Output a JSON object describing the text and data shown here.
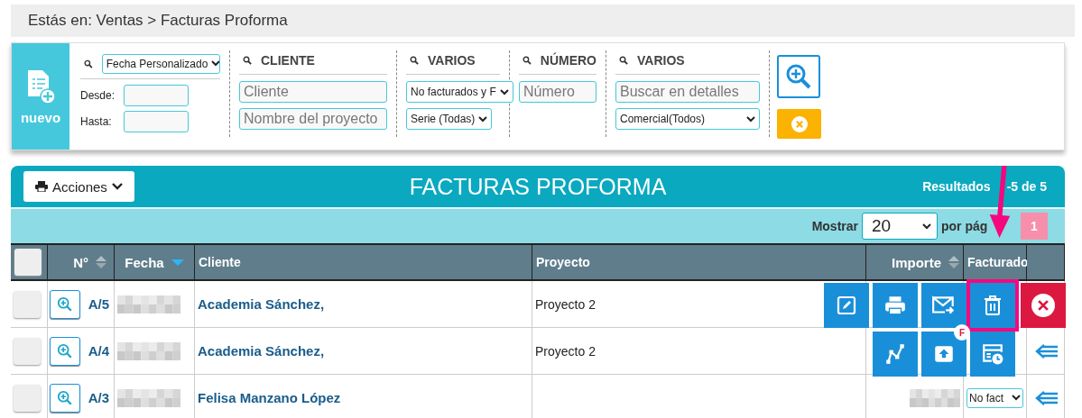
{
  "breadcrumb": "Estás en: Ventas > Facturas Proforma",
  "new_button": {
    "label": "nuevo"
  },
  "date_filter": {
    "select": "Fecha Personalizado",
    "from_label": "Desde:",
    "to_label": "Hasta:"
  },
  "filter_groups": [
    {
      "title": "CLIENTE",
      "fields": [
        {
          "kind": "input",
          "placeholder": "Cliente"
        },
        {
          "kind": "input",
          "placeholder": "Nombre del proyecto"
        }
      ]
    },
    {
      "title": "VARIOS",
      "fields": [
        {
          "kind": "select",
          "value": "No facturados y F"
        },
        {
          "kind": "select",
          "value": "Serie (Todas)"
        }
      ]
    },
    {
      "title": "NÚMERO",
      "fields": [
        {
          "kind": "input",
          "placeholder": "Número"
        }
      ]
    },
    {
      "title": "VARIOS",
      "fields": [
        {
          "kind": "input",
          "placeholder": "Buscar en detalles"
        },
        {
          "kind": "select",
          "value": "Comercial(Todos)"
        }
      ]
    }
  ],
  "table": {
    "title": "FACTURAS PROFORMA",
    "actions_button": "Acciones",
    "results": [
      "Resultados",
      "-5 de 5"
    ],
    "show_label": "Mostrar",
    "page_size": "20",
    "per_page_label": "por pág",
    "pages": [
      {
        "label": "1",
        "selected": true
      }
    ],
    "select_all_checked": false,
    "columns": [
      {
        "label": "N°",
        "sortable": true,
        "sorted": false
      },
      {
        "label": "Fecha",
        "sortable": true,
        "sorted": true
      },
      {
        "label": "Cliente",
        "sortable": false
      },
      {
        "label": "Proyecto",
        "sortable": false
      },
      {
        "label": "Importe",
        "sortable": true,
        "sorted": false
      },
      {
        "label": "Facturado",
        "sortable": false
      }
    ],
    "rows": [
      {
        "number": "A/5",
        "client": "Academia Sánchez,",
        "project": "Proyecto 2",
        "checked": false
      },
      {
        "number": "A/4",
        "client": "Academia Sánchez,",
        "project": "Proyecto 2",
        "checked": false
      },
      {
        "number": "A/3",
        "client": "Felisa Manzano López",
        "checked": false,
        "facturado": "No fact"
      }
    ]
  },
  "action_menu": [
    [
      {
        "kind": "edit"
      },
      {
        "kind": "print"
      },
      {
        "kind": "email"
      },
      {
        "kind": "delete",
        "highlighted": true
      },
      {
        "kind": "close"
      }
    ],
    [
      {
        "kind": "route"
      },
      {
        "kind": "upload",
        "badge": "F"
      },
      {
        "kind": "schedule"
      }
    ]
  ]
}
